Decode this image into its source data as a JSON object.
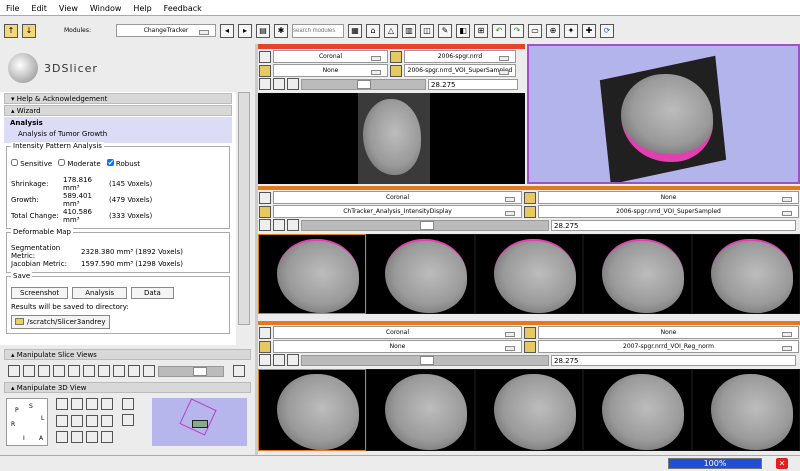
{
  "menu": [
    "File",
    "Edit",
    "View",
    "Window",
    "Help",
    "Feedback"
  ],
  "toolbar": {
    "modules_label": "Modules:",
    "module": "ChangeTracker",
    "search_placeholder": "search modules"
  },
  "logo": "3DSlicer",
  "panels": {
    "help": "Help & Acknowledgement",
    "wizard": "Wizard",
    "manip_slice": "Manipulate Slice Views",
    "manip_3d": "Manipulate 3D View"
  },
  "wizard": {
    "step": "Analysis",
    "desc": "Analysis of Tumor Growth",
    "intensity": {
      "title": "Intensity Pattern Analysis",
      "options": [
        {
          "label": "Sensitive",
          "checked": false
        },
        {
          "label": "Moderate",
          "checked": false
        },
        {
          "label": "Robust",
          "checked": true
        }
      ],
      "rows": [
        [
          "Shrinkage:",
          "178.816 mm³",
          "(145 Voxels)"
        ],
        [
          "Growth:",
          "589.401 mm³",
          "(479 Voxels)"
        ],
        [
          "Total Change:",
          "410.586 mm³",
          "(333 Voxels)"
        ]
      ]
    },
    "deformable": {
      "title": "Deformable Map",
      "rows": [
        [
          "Segmentation Metric:",
          "2328.380 mm³ (1892 Voxels)"
        ],
        [
          "Jacobian Metric:",
          "1597.590 mm³ (1298 Voxels)"
        ]
      ]
    },
    "save": {
      "title": "Save",
      "buttons": [
        "Screenshot",
        "Analysis",
        "Data"
      ],
      "note": "Results will be saved to directory:",
      "dir": "/scratch/Slicer3andrey"
    }
  },
  "orient": {
    "p": "P",
    "s": "S",
    "r": "R",
    "l": "L",
    "i": "I",
    "a": "A"
  },
  "views": [
    {
      "color": "#e8402a",
      "orientation": "Coronal",
      "fg": "2006-spgr.nrrd",
      "label": "None",
      "bg": "2006-spgr.nrrd_VOI_SuperSampled",
      "offset": "28.275"
    },
    {
      "color": "#e07a1a",
      "orientation": "Coronal",
      "fg": "None",
      "label": "ChTracker_Analysis_IntensityDisplay",
      "bg": "2006-spgr.nrrd_VOI_SuperSampled",
      "offset": "28.275"
    },
    {
      "color": "#e07a1a",
      "orientation": "Coronal",
      "fg": "None",
      "label": "None",
      "bg": "2007-spgr.nrrd_VOI_Reg_norm",
      "offset": "28.275"
    }
  ],
  "status": {
    "progress": "100%",
    "progress_value": 100
  }
}
